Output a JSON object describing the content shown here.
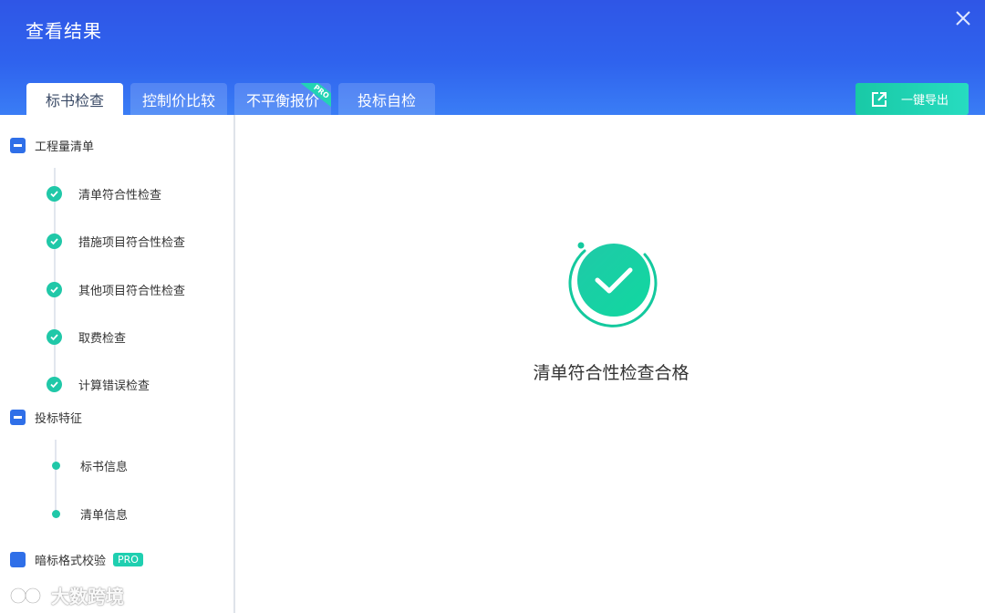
{
  "window": {
    "title": "查看结果"
  },
  "tabs": [
    {
      "label": "标书检查",
      "active": true
    },
    {
      "label": "控制价比较",
      "active": false
    },
    {
      "label": "不平衡报价",
      "active": false,
      "badge": "PRO"
    },
    {
      "label": "投标自检",
      "active": false
    }
  ],
  "toolbar": {
    "export_label": "一键导出"
  },
  "sidebar": {
    "groups": [
      {
        "label": "工程量清单",
        "items": [
          {
            "label": "清单符合性检查",
            "status": "passed"
          },
          {
            "label": "措施项目符合性检查",
            "status": "passed"
          },
          {
            "label": "其他项目符合性检查",
            "status": "passed"
          },
          {
            "label": "取费检查",
            "status": "passed"
          },
          {
            "label": "计算错误检查",
            "status": "passed"
          }
        ]
      },
      {
        "label": "投标特征",
        "items": [
          {
            "label": "标书信息"
          },
          {
            "label": "清单信息"
          }
        ]
      },
      {
        "label": "暗标格式校验",
        "badge": "PRO"
      }
    ]
  },
  "result": {
    "message": "清单符合性检查合格"
  },
  "watermark": {
    "text": "大数跨境"
  },
  "colors": {
    "header": "#2f5ce9",
    "accent": "#20c8a8",
    "checkbox": "#2f6fe8"
  }
}
